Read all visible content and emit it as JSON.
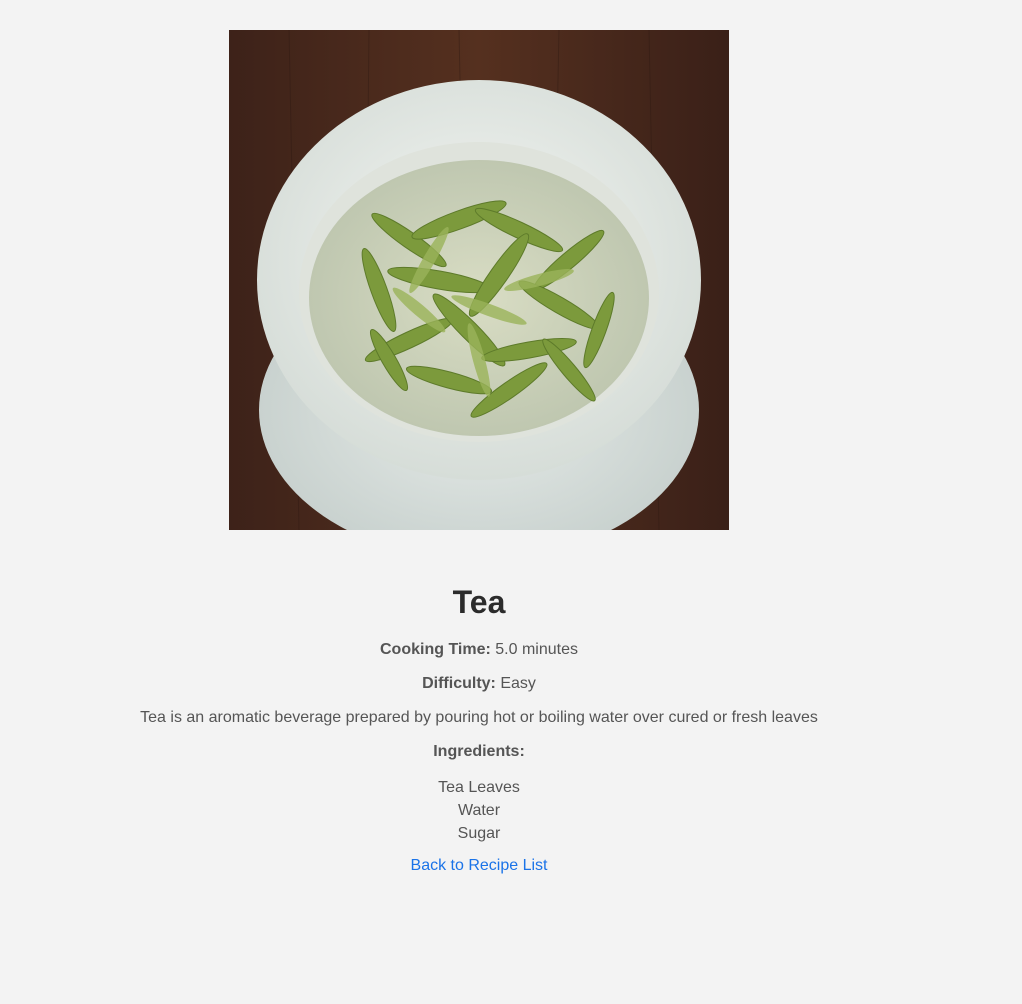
{
  "recipe": {
    "title": "Tea",
    "cooking_time_label": "Cooking Time:",
    "cooking_time_value": "5.0 minutes",
    "difficulty_label": "Difficulty:",
    "difficulty_value": "Easy",
    "description": "Tea is an aromatic beverage prepared by pouring hot or boiling water over cured or fresh leaves",
    "ingredients_label": "Ingredients:",
    "ingredients": [
      "Tea Leaves",
      "Water",
      "Sugar"
    ],
    "back_link": "Back to Recipe List"
  },
  "colors": {
    "background": "#f3f3f3",
    "text": "#555555",
    "heading": "#2b2b2b",
    "link": "#1a73e8",
    "table_wood": "#4a2a1d",
    "bowl_white": "#e9ece8",
    "tea_leaf_green": "#7c9a3c"
  }
}
